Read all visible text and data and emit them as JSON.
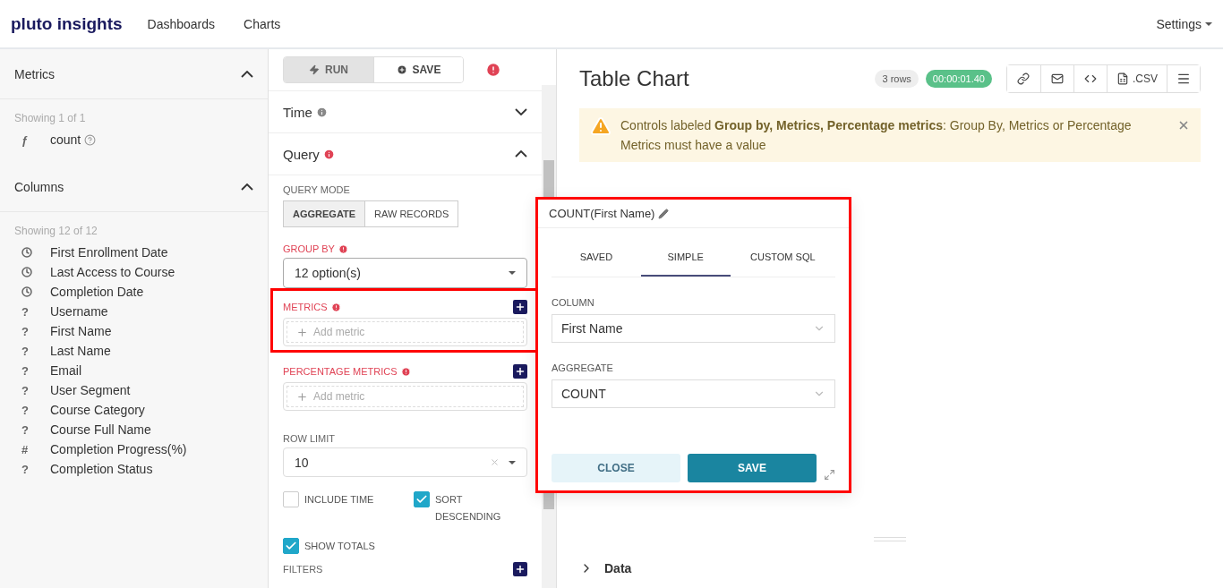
{
  "header": {
    "logo": "pluto insights",
    "nav": [
      {
        "label": "Dashboards"
      },
      {
        "label": "Charts"
      }
    ],
    "settings": "Settings"
  },
  "datasource": {
    "sections": [
      {
        "title": "Metrics",
        "expanded": true,
        "showing": "Showing 1 of 1",
        "items": [
          {
            "kind": "glyph",
            "glyph": "ƒ",
            "label": "count",
            "help": true
          }
        ]
      },
      {
        "title": "Columns",
        "expanded": true,
        "showing": "Showing 12 of 12",
        "items": [
          {
            "kind": "time",
            "label": "First Enrollment Date"
          },
          {
            "kind": "time",
            "label": "Last Access to Course"
          },
          {
            "kind": "time",
            "label": "Completion Date"
          },
          {
            "kind": "glyph",
            "glyph": "?",
            "label": "Username"
          },
          {
            "kind": "glyph",
            "glyph": "?",
            "label": "First Name"
          },
          {
            "kind": "glyph",
            "glyph": "?",
            "label": "Last Name"
          },
          {
            "kind": "glyph",
            "glyph": "?",
            "label": "Email"
          },
          {
            "kind": "glyph",
            "glyph": "?",
            "label": "User Segment"
          },
          {
            "kind": "glyph",
            "glyph": "?",
            "label": "Course Category"
          },
          {
            "kind": "glyph",
            "glyph": "?",
            "label": "Course Full Name"
          },
          {
            "kind": "glyph",
            "glyph": "#",
            "label": "Completion Progress(%)"
          },
          {
            "kind": "glyph",
            "glyph": "?",
            "label": "Completion Status"
          }
        ]
      }
    ]
  },
  "controls": {
    "actions": [
      {
        "kind": "run",
        "label": "RUN",
        "disabled": true
      },
      {
        "kind": "save",
        "label": "SAVE",
        "disabled": false
      }
    ],
    "has_error": true,
    "sections": [
      {
        "title": "Time",
        "expanded": false,
        "error": false
      },
      {
        "title": "Query",
        "expanded": true,
        "error": true
      }
    ],
    "query_mode": {
      "label": "QUERY MODE",
      "options": [
        {
          "label": "AGGREGATE",
          "selected": true
        },
        {
          "label": "RAW RECORDS",
          "selected": false
        }
      ]
    },
    "group_by": {
      "label": "GROUP BY",
      "error": true,
      "value": "12 option(s)"
    },
    "metric_fields": [
      {
        "label": "METRICS",
        "error": true,
        "placeholder": "Add metric",
        "highlighted": true
      },
      {
        "label": "PERCENTAGE METRICS",
        "error": true,
        "placeholder": "Add metric",
        "highlighted": false
      }
    ],
    "row_limit": {
      "label": "ROW LIMIT",
      "value": "10"
    },
    "checkboxes": [
      {
        "label": "INCLUDE TIME",
        "checked": false
      },
      {
        "label": "SORT DESCENDING",
        "checked": true
      },
      {
        "label": "SHOW TOTALS",
        "checked": true
      }
    ],
    "filters": {
      "label": "FILTERS"
    }
  },
  "chart": {
    "title": "Table Chart",
    "row_count": "3 rows",
    "timer": "00:00:01.40",
    "tools": [
      {
        "kind": "link"
      },
      {
        "kind": "mail"
      },
      {
        "kind": "code"
      },
      {
        "kind": "csv",
        "label": ".CSV"
      },
      {
        "kind": "menu"
      }
    ],
    "alert": "Controls labeled **Group by, Metrics, Percentage metrics**: Group By, Metrics or Percentage Metrics must have a value",
    "data_section": {
      "label": "Data",
      "expanded": false
    }
  },
  "popover": {
    "title": "COUNT(First Name)",
    "highlighted": true,
    "tabs": [
      {
        "label": "SAVED",
        "selected": false
      },
      {
        "label": "SIMPLE",
        "selected": true
      },
      {
        "label": "CUSTOM SQL",
        "selected": false
      }
    ],
    "fields": [
      {
        "label": "COLUMN",
        "value": "First Name"
      },
      {
        "label": "AGGREGATE",
        "value": "COUNT"
      }
    ],
    "buttons": [
      {
        "kind": "close",
        "label": "CLOSE"
      },
      {
        "kind": "save",
        "label": "SAVE"
      }
    ]
  }
}
